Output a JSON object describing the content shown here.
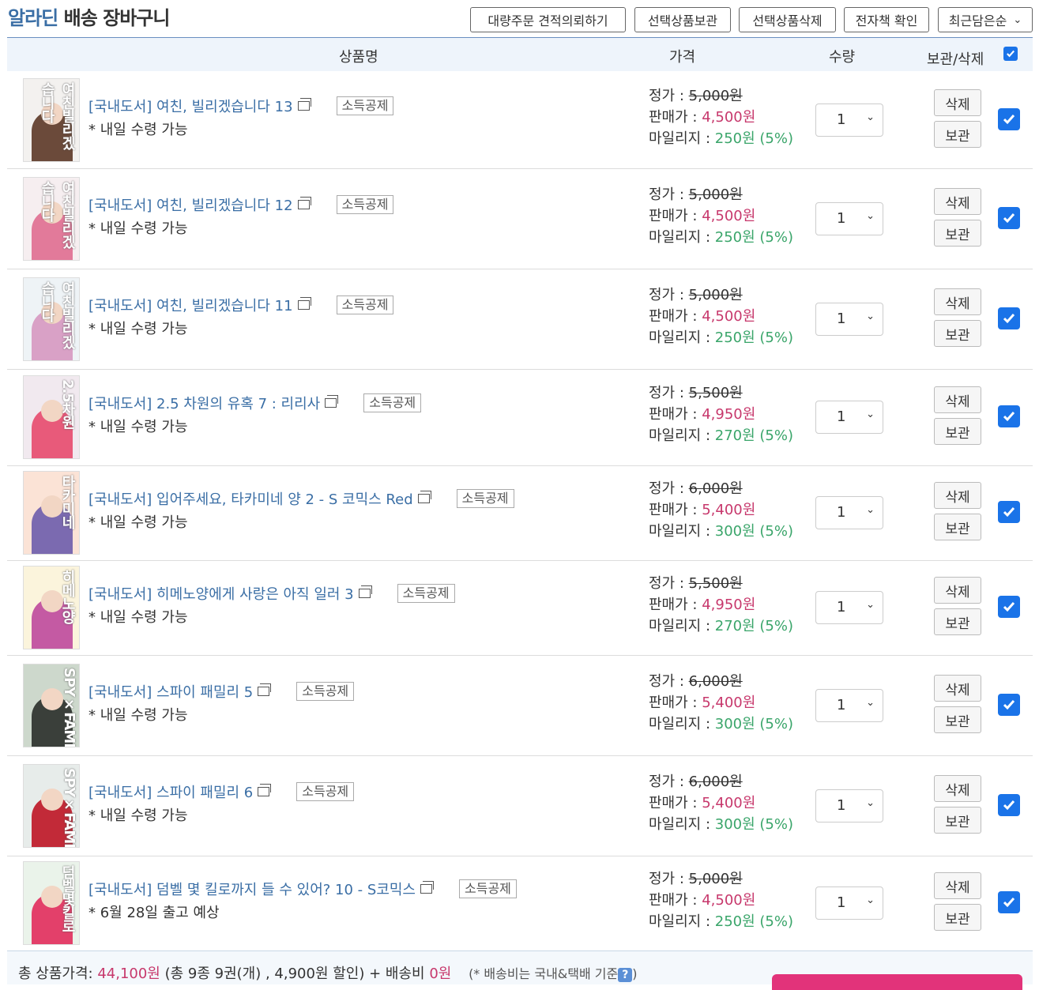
{
  "header": {
    "brand": "알라딘",
    "title": "배송 장바구니",
    "buttons": [
      "대량주문 견적의뢰하기",
      "선택상품보관",
      "선택상품삭제",
      "전자책 확인"
    ],
    "sort_selected": "최근담은순"
  },
  "table_header": {
    "product": "상품명",
    "price": "가격",
    "qty": "수량",
    "action": "보관/삭제"
  },
  "labels": {
    "list_price": "정가 : ",
    "sale_price": "판매가 : ",
    "mileage": "마일리지 : ",
    "tax_badge": "소득공제",
    "delete": "삭제",
    "keep": "보관"
  },
  "items": [
    {
      "name": "[국내도서] 여친, 빌리겠습니다 13",
      "delivery": "* 내일 수령 가능",
      "list": "5,000원",
      "sale": "4,500원",
      "mile": "250원",
      "rate": "(5%)",
      "qty": "1",
      "cover_title": "여친빌리겠습니다",
      "c1": "#f3f1ef",
      "c2": "#6b4a3a"
    },
    {
      "name": "[국내도서] 여친, 빌리겠습니다 12",
      "delivery": "* 내일 수령 가능",
      "list": "5,000원",
      "sale": "4,500원",
      "mile": "250원",
      "rate": "(5%)",
      "qty": "1",
      "cover_title": "여친빌리겠습니다",
      "c1": "#f6eef0",
      "c2": "#e27a9a"
    },
    {
      "name": "[국내도서] 여친, 빌리겠습니다 11",
      "delivery": "* 내일 수령 가능",
      "list": "5,000원",
      "sale": "4,500원",
      "mile": "250원",
      "rate": "(5%)",
      "qty": "1",
      "cover_title": "여친빌리겠습니다",
      "c1": "#eef3f6",
      "c2": "#d9a1c6"
    },
    {
      "name": "[국내도서] 2.5 차원의 유혹 7 : 리리사",
      "delivery": "* 내일 수령 가능",
      "list": "5,500원",
      "sale": "4,950원",
      "mile": "270원",
      "rate": "(5%)",
      "qty": "1",
      "cover_title": "2.5차원",
      "c1": "#f1e9ef",
      "c2": "#e85a7a"
    },
    {
      "name": "[국내도서] 입어주세요, 타카미네 양 2 - S 코믹스 Red",
      "delivery": "* 내일 수령 가능",
      "list": "6,000원",
      "sale": "5,400원",
      "mile": "300원",
      "rate": "(5%)",
      "qty": "1",
      "cover_title": "타카미네",
      "c1": "#fbe3d6",
      "c2": "#7b6ab0"
    },
    {
      "name": "[국내도서] 히메노양에게 사랑은 아직 일러 3",
      "delivery": "* 내일 수령 가능",
      "list": "5,500원",
      "sale": "4,950원",
      "mile": "270원",
      "rate": "(5%)",
      "qty": "1",
      "cover_title": "히메노양",
      "c1": "#fbf4dc",
      "c2": "#c45aa3"
    },
    {
      "name": "[국내도서] 스파이 패밀리 5",
      "delivery": "* 내일 수령 가능",
      "list": "6,000원",
      "sale": "5,400원",
      "mile": "300원",
      "rate": "(5%)",
      "qty": "1",
      "cover_title": "SPY×FAMILY",
      "c1": "#cdd8cc",
      "c2": "#3a3f3a"
    },
    {
      "name": "[국내도서] 스파이 패밀리 6",
      "delivery": "* 내일 수령 가능",
      "list": "6,000원",
      "sale": "5,400원",
      "mile": "300원",
      "rate": "(5%)",
      "qty": "1",
      "cover_title": "SPY×FAMILY",
      "c1": "#e7ecea",
      "c2": "#c22a38"
    },
    {
      "name": "[국내도서] 덤벨 몇 킬로까지 들 수 있어? 10 - S코믹스",
      "delivery": "* 6월 28일 출고 예상",
      "list": "5,000원",
      "sale": "4,500원",
      "mile": "250원",
      "rate": "(5%)",
      "qty": "1",
      "cover_title": "덤벨몇킬로",
      "c1": "#eaf3ea",
      "c2": "#e3406a"
    }
  ],
  "summary": {
    "label": "총 상품가격: ",
    "total": "44,100원",
    "detail_pre": " (총 ",
    "count": "9종 9권(개)",
    "detail_mid": " , ",
    "discount": "4,900원",
    "detail_post": " 할인) + 배송비 ",
    "shipping": "0원",
    "note": "(* 배송비는 국내&택배 기준",
    "note_icon": "?",
    "note_end": ")"
  }
}
